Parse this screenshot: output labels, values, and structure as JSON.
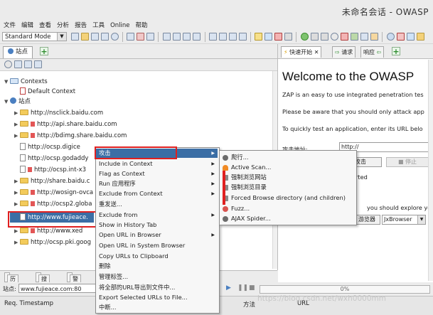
{
  "window": {
    "title": "未命名会话 - OWASP"
  },
  "menubar": [
    "文件",
    "编辑",
    "查看",
    "分析",
    "报告",
    "工具",
    "Online",
    "帮助"
  ],
  "toolbar": {
    "mode": "Standard Mode"
  },
  "left_tabs": {
    "sites": "站点"
  },
  "tree": {
    "contexts": "Contexts",
    "default_context": "Default Context",
    "sites_root": "站点",
    "sites": [
      {
        "label": "http://nsclick.baidu.com",
        "kind": "folder",
        "expanded": false
      },
      {
        "label": "http://api.share.baidu.com",
        "kind": "folder-flag",
        "expanded": false
      },
      {
        "label": "http://bdimg.share.baidu.com",
        "kind": "folder-flag",
        "expanded": false
      },
      {
        "label": "http://ocsp.digice",
        "kind": "file",
        "expanded": false
      },
      {
        "label": "http://ocsp.godaddy",
        "kind": "file",
        "expanded": false
      },
      {
        "label": "http://ocsp.int-x3",
        "kind": "file-flag",
        "expanded": false
      },
      {
        "label": "http://share.baidu.c",
        "kind": "folder",
        "expanded": false
      },
      {
        "label": "http://wosign-ovca",
        "kind": "folder-flag",
        "expanded": false
      },
      {
        "label": "http://ocsp2.globa",
        "kind": "folder-flag",
        "expanded": false
      },
      {
        "label": "http://www.fujieace.",
        "kind": "file",
        "expanded": false,
        "selected": true
      },
      {
        "label": "http://www.xed",
        "kind": "folder-flag",
        "expanded": false
      },
      {
        "label": "http://ocsp.pki.goog",
        "kind": "folder",
        "expanded": false
      }
    ]
  },
  "bottom_tabs": [
    "历史",
    "搜索",
    "警报"
  ],
  "status": {
    "site_label": "站点:",
    "site_value": "www.fujieace.com:80",
    "progress": "0%",
    "progress_value": 0
  },
  "table_header": {
    "col1": "Req. Timestamp",
    "col2": "方法",
    "col3": "URL"
  },
  "right_tabs": {
    "quick_start": "快速开始",
    "request": "请求",
    "response": "响应"
  },
  "welcome": {
    "heading": "Welcome to the OWASP",
    "line1": "ZAP is an easy to use integrated penetration tes",
    "line2": "Please be aware that you should only attack app",
    "line3": "To quickly test an application, enter its URL belo",
    "attack_label": "攻击地址:",
    "url_value": "http://",
    "attack_button": "攻击",
    "stop_button": "停止",
    "progress_label": "arted",
    "explore_line": "you should explore your",
    "browser_button": "游览器",
    "browser_select": "JxBrowser"
  },
  "context_menu": {
    "items": [
      {
        "label": "攻击",
        "submenu": true,
        "highlighted": true
      },
      {
        "label": "Include in Context",
        "submenu": true
      },
      {
        "label": "Flag as Context",
        "submenu": true
      },
      {
        "label": "Run 应用程序",
        "submenu": true
      },
      {
        "label": "Exclude from Context",
        "submenu": true
      },
      {
        "label": "重发送...",
        "submenu": false
      },
      {
        "label": "Exclude from",
        "submenu": true
      },
      {
        "label": "Show in History Tab",
        "submenu": false
      },
      {
        "label": "Open URL in Browser",
        "submenu": true
      },
      {
        "label": "Open URL in System Browser",
        "submenu": false
      },
      {
        "label": "Copy URLs to Clipboard",
        "submenu": false
      },
      {
        "label": "删除",
        "submenu": false
      },
      {
        "label": "管理标签...",
        "submenu": false
      },
      {
        "label": "将全部的URL导出到文件中...",
        "submenu": false
      },
      {
        "label": "Export Selected URLs to File...",
        "submenu": false
      },
      {
        "label": "中断...",
        "submenu": false
      }
    ]
  },
  "attack_submenu": {
    "items": [
      {
        "label": "爬行...",
        "icon": "spider-icon"
      },
      {
        "label": "Active Scan...",
        "icon": "flame-icon"
      },
      {
        "label": "强制浏览网站",
        "icon": "hammer-icon"
      },
      {
        "label": "强制浏览目录",
        "icon": "hammer-icon"
      },
      {
        "label": "Forced Browse directory (and children)",
        "icon": "hammer-icon"
      },
      {
        "label": "Fuzz...",
        "icon": "fuzz-icon"
      },
      {
        "label": "AJAX Spider...",
        "icon": "ajax-spider-icon"
      }
    ]
  },
  "watermark": "https://blog.csdn.net/wxh0000mm",
  "colors": {
    "selection": "#3b6ea5",
    "highlight_box": "#e02020"
  }
}
